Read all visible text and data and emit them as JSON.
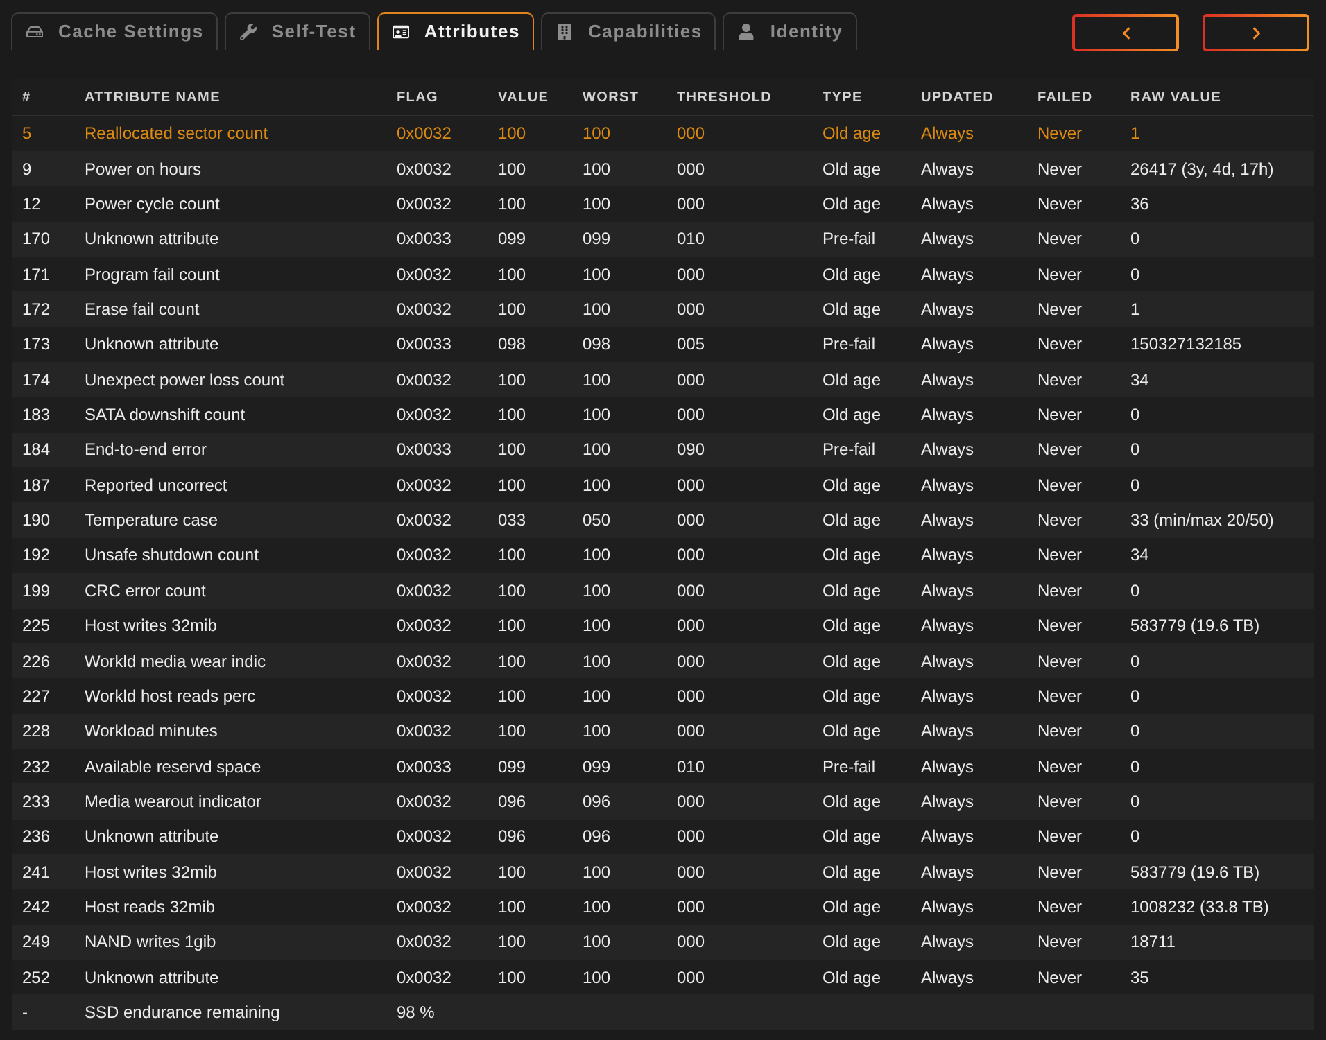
{
  "tabs": [
    {
      "label": "Cache Settings",
      "selected": false
    },
    {
      "label": "Self-Test",
      "selected": false
    },
    {
      "label": "Attributes",
      "selected": true
    },
    {
      "label": "Capabilities",
      "selected": false
    },
    {
      "label": "Identity",
      "selected": false
    }
  ],
  "table": {
    "columns": [
      "#",
      "ATTRIBUTE NAME",
      "FLAG",
      "VALUE",
      "WORST",
      "THRESHOLD",
      "TYPE",
      "UPDATED",
      "FAILED",
      "RAW VALUE"
    ],
    "rows": [
      {
        "warning": true,
        "cells": [
          "5",
          "Reallocated sector count",
          "0x0032",
          "100",
          "100",
          "000",
          "Old age",
          "Always",
          "Never",
          "1"
        ]
      },
      {
        "warning": false,
        "cells": [
          "9",
          "Power on hours",
          "0x0032",
          "100",
          "100",
          "000",
          "Old age",
          "Always",
          "Never",
          "26417 (3y, 4d, 17h)"
        ]
      },
      {
        "warning": false,
        "cells": [
          "12",
          "Power cycle count",
          "0x0032",
          "100",
          "100",
          "000",
          "Old age",
          "Always",
          "Never",
          "36"
        ]
      },
      {
        "warning": false,
        "cells": [
          "170",
          "Unknown attribute",
          "0x0033",
          "099",
          "099",
          "010",
          "Pre-fail",
          "Always",
          "Never",
          "0"
        ]
      },
      {
        "warning": false,
        "cells": [
          "171",
          "Program fail count",
          "0x0032",
          "100",
          "100",
          "000",
          "Old age",
          "Always",
          "Never",
          "0"
        ]
      },
      {
        "warning": false,
        "cells": [
          "172",
          "Erase fail count",
          "0x0032",
          "100",
          "100",
          "000",
          "Old age",
          "Always",
          "Never",
          "1"
        ]
      },
      {
        "warning": false,
        "cells": [
          "173",
          "Unknown attribute",
          "0x0033",
          "098",
          "098",
          "005",
          "Pre-fail",
          "Always",
          "Never",
          "150327132185"
        ]
      },
      {
        "warning": false,
        "cells": [
          "174",
          "Unexpect power loss count",
          "0x0032",
          "100",
          "100",
          "000",
          "Old age",
          "Always",
          "Never",
          "34"
        ]
      },
      {
        "warning": false,
        "cells": [
          "183",
          "SATA downshift count",
          "0x0032",
          "100",
          "100",
          "000",
          "Old age",
          "Always",
          "Never",
          "0"
        ]
      },
      {
        "warning": false,
        "cells": [
          "184",
          "End-to-end error",
          "0x0033",
          "100",
          "100",
          "090",
          "Pre-fail",
          "Always",
          "Never",
          "0"
        ]
      },
      {
        "warning": false,
        "cells": [
          "187",
          "Reported uncorrect",
          "0x0032",
          "100",
          "100",
          "000",
          "Old age",
          "Always",
          "Never",
          "0"
        ]
      },
      {
        "warning": false,
        "cells": [
          "190",
          "Temperature case",
          "0x0032",
          "033",
          "050",
          "000",
          "Old age",
          "Always",
          "Never",
          "33 (min/max 20/50)"
        ]
      },
      {
        "warning": false,
        "cells": [
          "192",
          "Unsafe shutdown count",
          "0x0032",
          "100",
          "100",
          "000",
          "Old age",
          "Always",
          "Never",
          "34"
        ]
      },
      {
        "warning": false,
        "cells": [
          "199",
          "CRC error count",
          "0x0032",
          "100",
          "100",
          "000",
          "Old age",
          "Always",
          "Never",
          "0"
        ]
      },
      {
        "warning": false,
        "cells": [
          "225",
          "Host writes 32mib",
          "0x0032",
          "100",
          "100",
          "000",
          "Old age",
          "Always",
          "Never",
          "583779 (19.6 TB)"
        ]
      },
      {
        "warning": false,
        "cells": [
          "226",
          "Workld media wear indic",
          "0x0032",
          "100",
          "100",
          "000",
          "Old age",
          "Always",
          "Never",
          "0"
        ]
      },
      {
        "warning": false,
        "cells": [
          "227",
          "Workld host reads perc",
          "0x0032",
          "100",
          "100",
          "000",
          "Old age",
          "Always",
          "Never",
          "0"
        ]
      },
      {
        "warning": false,
        "cells": [
          "228",
          "Workload minutes",
          "0x0032",
          "100",
          "100",
          "000",
          "Old age",
          "Always",
          "Never",
          "0"
        ]
      },
      {
        "warning": false,
        "cells": [
          "232",
          "Available reservd space",
          "0x0033",
          "099",
          "099",
          "010",
          "Pre-fail",
          "Always",
          "Never",
          "0"
        ]
      },
      {
        "warning": false,
        "cells": [
          "233",
          "Media wearout indicator",
          "0x0032",
          "096",
          "096",
          "000",
          "Old age",
          "Always",
          "Never",
          "0"
        ]
      },
      {
        "warning": false,
        "cells": [
          "236",
          "Unknown attribute",
          "0x0032",
          "096",
          "096",
          "000",
          "Old age",
          "Always",
          "Never",
          "0"
        ]
      },
      {
        "warning": false,
        "cells": [
          "241",
          "Host writes 32mib",
          "0x0032",
          "100",
          "100",
          "000",
          "Old age",
          "Always",
          "Never",
          "583779 (19.6 TB)"
        ]
      },
      {
        "warning": false,
        "cells": [
          "242",
          "Host reads 32mib",
          "0x0032",
          "100",
          "100",
          "000",
          "Old age",
          "Always",
          "Never",
          "1008232 (33.8 TB)"
        ]
      },
      {
        "warning": false,
        "cells": [
          "249",
          "NAND writes 1gib",
          "0x0032",
          "100",
          "100",
          "000",
          "Old age",
          "Always",
          "Never",
          "18711"
        ]
      },
      {
        "warning": false,
        "cells": [
          "252",
          "Unknown attribute",
          "0x0032",
          "100",
          "100",
          "000",
          "Old age",
          "Always",
          "Never",
          "35"
        ]
      },
      {
        "warning": false,
        "cells": [
          "-",
          "SSD endurance remaining",
          "98 %"
        ]
      }
    ]
  }
}
